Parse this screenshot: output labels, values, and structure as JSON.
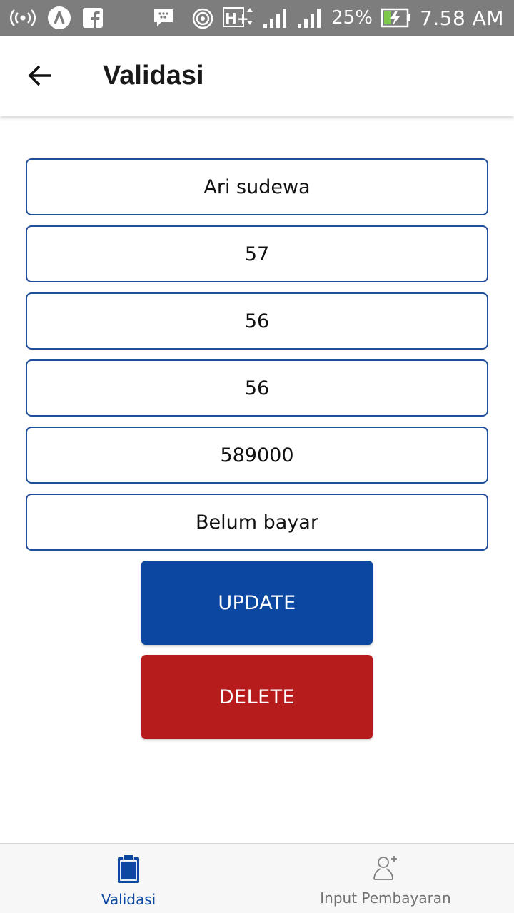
{
  "status_bar": {
    "battery_percent": "25%",
    "time": "7.58 AM",
    "network": "H+",
    "icons": [
      "hotspot-icon",
      "nav-icon",
      "facebook-icon",
      "bbm-icon",
      "wifi-icon",
      "network-type-icon",
      "signal-icon",
      "signal-icon-2",
      "battery-icon"
    ]
  },
  "app_bar": {
    "title": "Validasi",
    "back_icon": "arrow-left-icon"
  },
  "form": {
    "name": "Ari sudewa",
    "field2": "57",
    "field3": "56",
    "field4": "56",
    "amount": "589000",
    "status": "Belum bayar"
  },
  "actions": {
    "update_label": "UPDATE",
    "delete_label": "DELETE",
    "update_color": "#0c47a1",
    "delete_color": "#b71c1c"
  },
  "bottom_nav": {
    "items": [
      {
        "label": "Validasi",
        "icon": "clipboard-icon",
        "active": true
      },
      {
        "label": "Input Pembayaran",
        "icon": "add-user-icon",
        "active": false
      }
    ],
    "accent": "#0c47a1"
  }
}
